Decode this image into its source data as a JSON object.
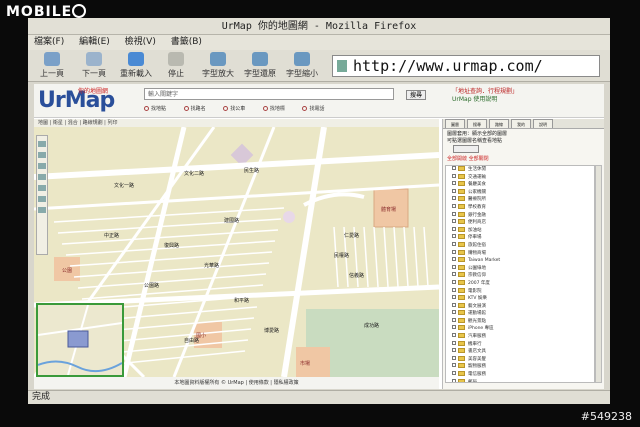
{
  "watermark": {
    "text": "MOBILE",
    "badge": "01"
  },
  "photo_id": "#549238",
  "browser": {
    "title": "UrMap 你的地圖網 - Mozilla Firefox",
    "menu": [
      "檔案(F)",
      "編輯(E)",
      "檢視(V)",
      "書籤(B)"
    ],
    "toolbar": [
      {
        "label": "上一頁",
        "icon": "back-arrow-icon"
      },
      {
        "label": "下一頁",
        "icon": "forward-arrow-icon"
      },
      {
        "label": "重新載入",
        "icon": "reload-icon"
      },
      {
        "label": "停止",
        "icon": "stop-icon"
      },
      {
        "label": "字型放大",
        "icon": "zoom-in-icon"
      },
      {
        "label": "字型還原",
        "icon": "zoom-reset-icon"
      },
      {
        "label": "字型縮小",
        "icon": "zoom-out-icon"
      }
    ],
    "url": "http://www.urmap.com/",
    "status": "完成"
  },
  "site": {
    "logo": "UrMap",
    "logo_sub": "你的地圖網",
    "search_placeholder": "輸入關鍵字",
    "search_button": "搜尋",
    "radio_options": [
      "找地點",
      "找路名",
      "找公車",
      "找地標",
      "找電話"
    ],
    "promo_line1": "「地址查詢．行程規劃」",
    "promo_line2": "UrMap 使用說明",
    "map_toolbar": "地圖 | 衛星 | 混合 | 路線規劃 | 列印",
    "map_footer": "本地圖資料版權所有 © UrMap | 使用條款 | 隱私權政策"
  },
  "panel": {
    "tabs": [
      "圖層",
      "搜尋",
      "路線",
      "我的",
      "說明"
    ],
    "info_lines": [
      "圖層套用：顯示全部的圖層",
      "可點選圖層名稱查看地點"
    ],
    "highlight": "全部開啟  全部關閉",
    "layers": [
      "生活休閒",
      "交通運輸",
      "餐廳美食",
      "公家機關",
      "醫療院所",
      "學校教育",
      "銀行金融",
      "便利商店",
      "加油站",
      "停車場",
      "旅館住宿",
      "購物商場",
      "Taiwan Market",
      "公園綠地",
      "宗教信仰",
      "2007 年度",
      "電影院",
      "KTV 娛樂",
      "藝文展演",
      "運動場館",
      "觀光景點",
      "iPhone 專區",
      "汽車服務",
      "機車行",
      "書店文具",
      "美容美髮",
      "寵物服務",
      "電信服務",
      "郵局",
      "警察局",
      "消防局"
    ]
  },
  "map_labels": [
    "文化一路",
    "文化二路",
    "民生路",
    "中正路",
    "復興路",
    "建國路",
    "光華路",
    "民權路",
    "仁愛路",
    "信義路",
    "和平路",
    "自由路",
    "中山路",
    "成功路",
    "公園路",
    "博愛路"
  ],
  "map_places": [
    "體育場",
    "公園",
    "國小",
    "市場"
  ],
  "colors": {
    "map_bg": "#ebe7c6",
    "road": "#ffffff",
    "accent": "#2a4f9a",
    "brand_red": "#d33333",
    "minimap_border": "#3a9a3a"
  }
}
